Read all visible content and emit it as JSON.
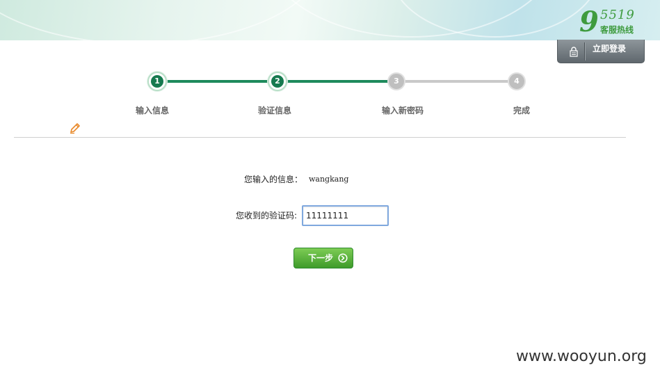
{
  "header": {
    "hotline_number": "95519",
    "hotline_number_tail": "5519",
    "hotline_number_head": "9",
    "hotline_label": "客服热线",
    "login_button": "立即登录",
    "brand_color": "#3e9b3e"
  },
  "steps": [
    {
      "number": "1",
      "label": "输入信息",
      "status": "done"
    },
    {
      "number": "2",
      "label": "验证信息",
      "status": "done"
    },
    {
      "number": "3",
      "label": "输入新密码",
      "status": "todo"
    },
    {
      "number": "4",
      "label": "完成",
      "status": "todo"
    }
  ],
  "form": {
    "info_label": "您输入的信息：",
    "info_value": "wangkang",
    "code_label": "您收到的验证码:",
    "code_value": "11111111",
    "next_button": "下一步"
  },
  "watermark": "www.wooyun.org"
}
